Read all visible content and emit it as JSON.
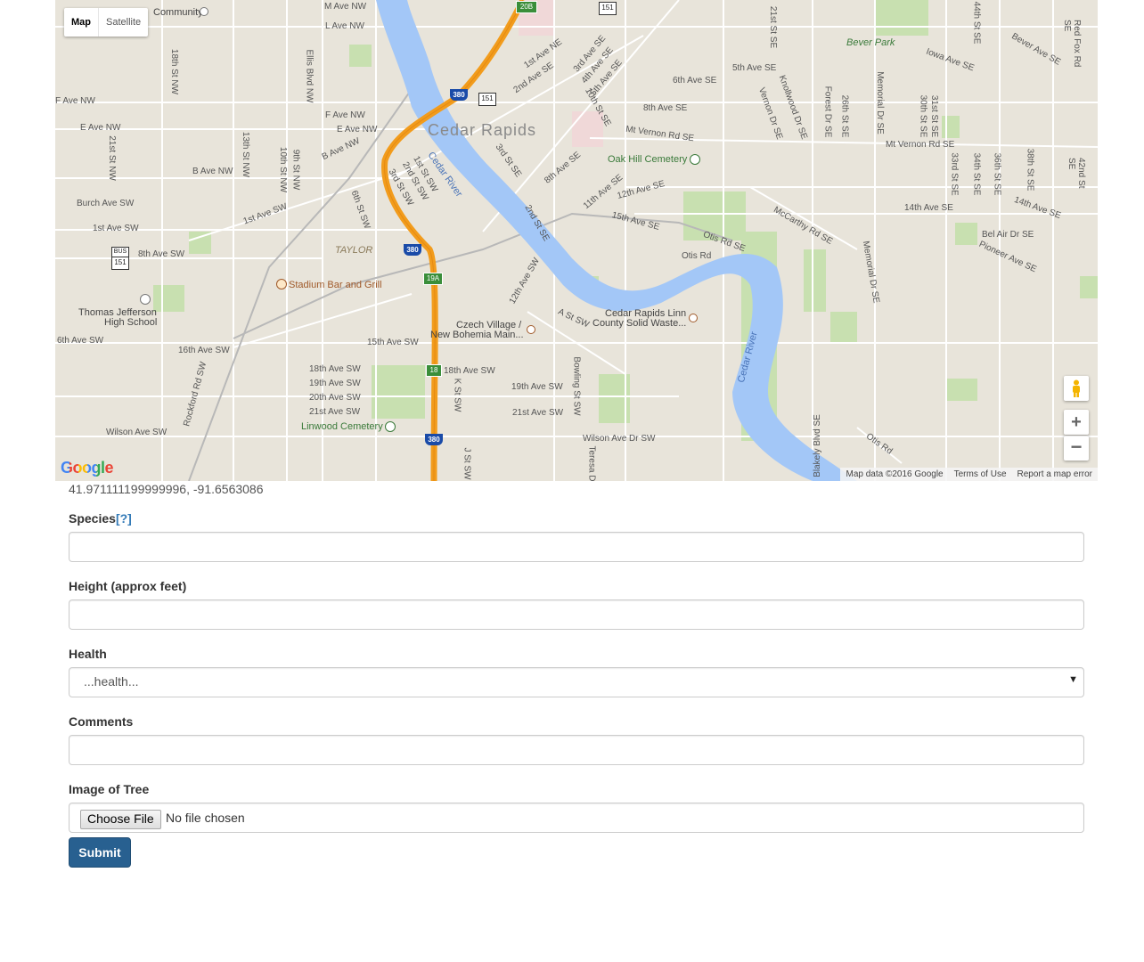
{
  "map": {
    "type_buttons": {
      "map": "Map",
      "satellite": "Satellite"
    },
    "google_logo": "Google",
    "attribution": {
      "data": "Map data ©2016 Google",
      "terms": "Terms of Use",
      "report": "Report a map error"
    },
    "zoom": {
      "in": "+",
      "out": "−"
    },
    "labels": {
      "city": "Cedar Rapids",
      "river1": "Cedar River",
      "river2": "Cedar River",
      "community": "Community",
      "bever_park": "Bever Park",
      "oak_hill": "Oak Hill Cemetery",
      "taylor": "TAYLOR",
      "stadium": "Stadium Bar and Grill",
      "jefferson1": "Thomas Jefferson",
      "jefferson2": "High School",
      "czech1": "Czech Village /",
      "czech2": "New Bohemia Main...",
      "linn1": "Cedar Rapids Linn",
      "linn2": "County Solid Waste...",
      "linwood": "Linwood Cemetery",
      "m_ave_nw": "M Ave NW",
      "l_ave_nw": "L Ave NW",
      "f_ave_nw": "F Ave NW",
      "e_ave_nw": "E Ave NW",
      "f_ave_nw2": "F Ave NW",
      "e_ave_nw2": "E Ave NW",
      "b_ave_nw": "B Ave NW",
      "b_ave_nw2": "B Ave NW",
      "burch_ave": "Burch Ave SW",
      "first_ave_sw": "1st Ave SW",
      "first_ave_sw2": "1st Ave SW",
      "eighth_ave_sw": "8th Ave SW",
      "sixth_ave_sw": "6th Ave SW",
      "sixteenth_ave_sw": "16th Ave SW",
      "fifteenth_ave_sw": "15th Ave SW",
      "eighteenth_ave_sw": "18th Ave SW",
      "eighteenth_ave_sw2": "18th Ave SW",
      "nineteenth_ave_sw": "19th Ave SW",
      "nineteenth_ave_sw2": "19th Ave SW",
      "twentieth_ave_sw": "20th Ave SW",
      "twentyfirst_ave_sw": "21st Ave SW",
      "twentyfirst_ave_sw2": "21st Ave SW",
      "wilson_ave_sw": "Wilson Ave SW",
      "wilson_ave_dr": "Wilson Ave Dr SW",
      "mt_vernon1": "Mt Vernon Rd SE",
      "mt_vernon2": "Mt Vernon Rd SE",
      "sixth_ave_se": "6th Ave SE",
      "fifth_ave_se": "5th Ave SE",
      "eighth_ave_se": "8th Ave SE",
      "fourteenth_ave_se": "14th Ave SE",
      "fourteenth_ave_se2": "14th Ave SE",
      "fifteenth_ave_se": "15th Ave SE",
      "twelfth_ave_se": "12th Ave SE",
      "eleventh_ave_se": "11th Ave SE",
      "bel_air": "Bel Air Dr SE",
      "pioneer": "Pioneer Ave SE",
      "iowa_ave": "Iowa Ave SE",
      "bever_ave": "Bever Ave SE",
      "otis_rd_se": "Otis Rd SE",
      "otis_rd": "Otis Rd",
      "otis_rd2": "Otis Rd",
      "mccarthy": "McCarthy Rd SE",
      "memorial1": "Memorial Dr SE",
      "memorial2": "Memorial Dr SE",
      "a_st_sw": "A St SW",
      "twelfth_ave_sw": "12th Ave SW",
      "first_ave_ne": "1st Ave NE",
      "second_ave_se": "2nd Ave SE",
      "third_ave_se": "3rd Ave SE",
      "fourth_ave_se": "4th Ave SE",
      "fifth_ave_se2": "5th Ave SE",
      "tenth_st_se": "10th St SE",
      "eighth_ave_se2": "8th Ave SE",
      "third_st_se": "3rd St SE",
      "second_st_se": "2nd St SE",
      "first_st_sw": "1st St SW",
      "second_st_sw": "2nd St SW",
      "third_st_sw": "3rd St SW",
      "sixth_st_sw": "6th St SW",
      "ninth_st_nw": "9th St NW",
      "tenth_st_nw": "10th St NW",
      "thirteenth_st_nw": "13th St NW",
      "eighteenth_st_nw": "18th St NW",
      "twentyfirst_st_nw": "21st St NW",
      "ellis": "Ellis Blvd NW",
      "rockford": "Rockford Rd SW",
      "bowling": "Bowling St SW",
      "k_st": "K St SW",
      "j_st": "J St SW",
      "teresa": "Teresa D",
      "blakely": "Blakely Blvd SE",
      "forest": "Forest Dr SE",
      "vernon_dr": "Vernon Dr SE",
      "knollwood": "Knollwood Dr SE",
      "twentysixth": "26th St SE",
      "thirtieth": "30th St SE",
      "thirtyfirst": "31st St SE",
      "thirtythird": "33rd St SE",
      "thirtyfourth": "34th St SE",
      "thirtysixth": "36th St SE",
      "thirtyeighth": "38th St SE",
      "fortysecond": "42nd St SE",
      "twentyfirst_st_se": "21st St SE",
      "red_fox": "Red Fox Rd SE",
      "fortyfourth": "44th St SE",
      "memorial_dr_se": "Memorial Dr SE",
      "hwy_380a": "380",
      "hwy_380b": "380",
      "hwy_380c": "380",
      "hwy_151a": "151",
      "hwy_151b": "151",
      "hwy_151c": "151",
      "exit_20b": "20B",
      "exit_19a": "19A",
      "exit_18": "18",
      "bus": "BUS"
    }
  },
  "coordinates": "41.971111199999996, -91.6563086",
  "form": {
    "species": {
      "label": "Species",
      "help": "[?]",
      "value": ""
    },
    "height": {
      "label": "Height (approx feet)",
      "value": ""
    },
    "health": {
      "label": "Health",
      "selected": "...health..."
    },
    "comments": {
      "label": "Comments",
      "value": ""
    },
    "image": {
      "label": "Image of Tree",
      "button": "Choose File",
      "status": "No file chosen"
    },
    "submit": "Submit"
  }
}
